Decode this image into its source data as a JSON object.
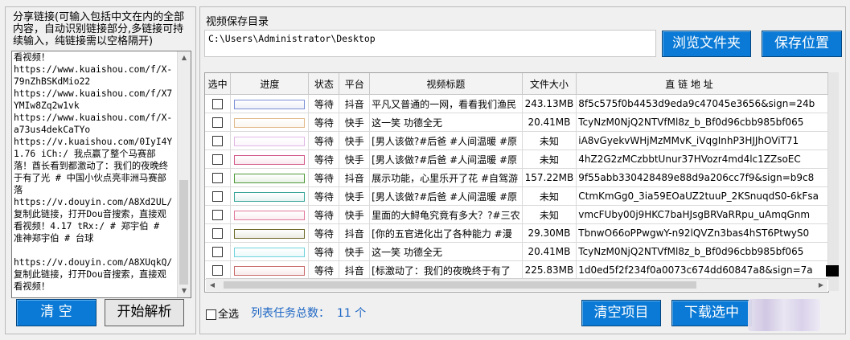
{
  "share": {
    "label": "分享链接(可输入包括中文在内的全部内容，自动识别链接部分,多链接可持续输入，纯链接需以空格隔开)",
    "text": "看视频！\nhttps://www.kuaishou.com/f/X-79nZhBSKdMio22\nhttps://www.kuaishou.com/f/X7YMIw8Zq2w1vk\nhttps://www.kuaishou.com/f/X-a73us4dekCaTYo\nhttps://v.kuaishou.com/0IyI4Y\n1.76 iCh:/ 我点赢了整个马赛部落！酋长看到都激动了：我们的夜晚终于有了光 # 中国小伙点亮非洲马赛部落\nhttps://v.douyin.com/A8Xd2UL/ 复制此链接，打开Dou音搜索，直接观看视频！4.17 tRx:/ # 郑宇伯 # 准神郑宇伯 # 台球\n\nhttps://v.douyin.com/A8XUqkQ/ 复制此链接，打开Dou音搜索，直接观看视频！"
  },
  "buttons": {
    "clear": "清  空",
    "parse": "开始解析",
    "browse": "浏览文件夹",
    "save_location": "保存位置",
    "clear_items": "清空项目",
    "download_selected": "下载选中"
  },
  "save_dir": {
    "label": "视频保存目录",
    "value": "C:\\Users\\Administrator\\Desktop"
  },
  "table": {
    "headers": [
      "选中",
      "进度",
      "状态",
      "平台",
      "视频标题",
      "文件大小",
      "直 链 地 址"
    ],
    "rows": [
      {
        "status": "等待",
        "platform": "抖音",
        "title": "平凡又普通的一网，看看我们渔民",
        "size": "243.13MB",
        "url": "8f5c575f0b4453d9eda9c47045e3656&sign=24b",
        "bar": "#7c8fd6"
      },
      {
        "status": "等待",
        "platform": "快手",
        "title": "这一笑 功德全无",
        "size": "20.41MB",
        "url": "TcyNzM0NjQ2NTVfMl8z_b_Bf0d96cbb985bf065",
        "bar": "#e1b98a"
      },
      {
        "status": "等待",
        "platform": "快手",
        "title": "[男人该做?#后爸 #人间温暖 #原",
        "size": "未知",
        "url": "iA8vGyekvWHjMzMMvK_iVqgInhP3HJJhOViT71",
        "bar": "#e2b8e6"
      },
      {
        "status": "等待",
        "platform": "快手",
        "title": "[男人该做?#后爸 #人间温暖 #原",
        "size": "未知",
        "url": "4hZ2G2zMCzbbtUnur37HVozr4md4lc1ZZsoEC",
        "bar": "#d25a8a"
      },
      {
        "status": "等待",
        "platform": "抖音",
        "title": "展示功能，心里乐开了花 #自驾游",
        "size": "157.22MB",
        "url": "9f55abb330428489e88d9a206cc7f9&sign=b9c8",
        "bar": "#4f9a3a"
      },
      {
        "status": "等待",
        "platform": "快手",
        "title": "[男人该做?#后爸 #人间温暖 #原",
        "size": "未知",
        "url": "CtmKmGg0_3ia59EOaUZ2tuuP_2KSnuqdS0-6kFsa",
        "bar": "#3aa59a"
      },
      {
        "status": "等待",
        "platform": "快手",
        "title": "里面的大鲟龟究竟有多大？?#三农",
        "size": "未知",
        "url": "vmcFUby00j9HKC7baHJsgBRVaRRpu_uAmqGnm",
        "bar": "#e07a9a"
      },
      {
        "status": "等待",
        "platform": "抖音",
        "title": "[你的五官进化出了各种能力 #漫",
        "size": "29.30MB",
        "url": "TbnwO66oPPwgwY-n92lQVZn3bas4hST6PtwyS0",
        "bar": "#6d6a2a"
      },
      {
        "status": "等待",
        "platform": "快手",
        "title": "这一笑 功德全无",
        "size": "20.41MB",
        "url": "TcyNzM0NjQ2NTVfMl8z_b_Bf0d96cbb985bf065",
        "bar": "#6fd3dc"
      },
      {
        "status": "等待",
        "platform": "抖音",
        "title": "[标激动了：我们的夜晚终于有了",
        "size": "225.83MB",
        "url": "1d0ed5f2f234f0a0073c674dd60847a8&sign=7a",
        "bar": "#c86a6a"
      }
    ]
  },
  "footer": {
    "select_all": "全选",
    "task_count_label": "列表任务总数：",
    "task_count": "11",
    "task_count_unit": "个"
  }
}
